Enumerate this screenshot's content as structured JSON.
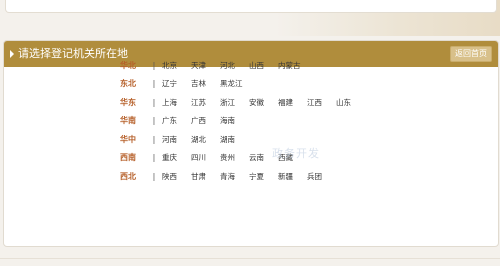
{
  "panel": {
    "title": "请选择登记机关所在地",
    "back_button": "返回首页"
  },
  "regions": [
    {
      "name": "华北",
      "sep": "|",
      "provinces": [
        "北京",
        "天津",
        "河北",
        "山西",
        "内蒙古"
      ]
    },
    {
      "name": "东北",
      "sep": "|",
      "provinces": [
        "辽宁",
        "吉林",
        "黑龙江"
      ]
    },
    {
      "name": "华东",
      "sep": "|",
      "provinces": [
        "上海",
        "江苏",
        "浙江",
        "安徽",
        "福建",
        "江西",
        "山东"
      ]
    },
    {
      "name": "华南",
      "sep": "|",
      "provinces": [
        "广东",
        "广西",
        "海南"
      ]
    },
    {
      "name": "华中",
      "sep": "|",
      "provinces": [
        "河南",
        "湖北",
        "湖南"
      ]
    },
    {
      "name": "西南",
      "sep": "|",
      "provinces": [
        "重庆",
        "四川",
        "贵州",
        "云南",
        "西藏"
      ]
    },
    {
      "name": "西北",
      "sep": "|",
      "provinces": [
        "陕西",
        "甘肃",
        "青海",
        "宁夏",
        "新疆",
        "兵团"
      ]
    }
  ],
  "watermark": "政务开发",
  "colors": {
    "header": "#b08d3c",
    "region_label": "#b6602a",
    "back_button_bg": "#d8c08a"
  },
  "icons": {
    "header_marker": "triangle-right-icon"
  }
}
